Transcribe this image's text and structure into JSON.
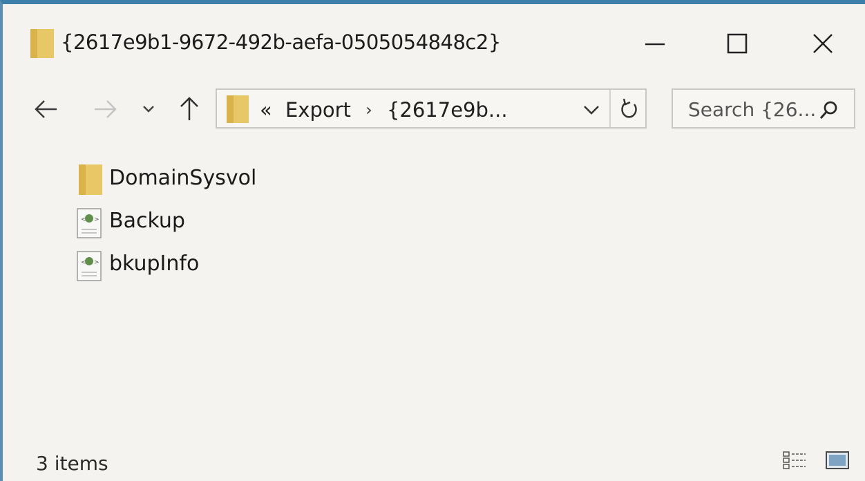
{
  "window": {
    "title": "{2617e9b1-9672-492b-aefa-0505054848c2}",
    "accent_color": "#3c7fa8"
  },
  "titlebar": {
    "icon": "folder-icon",
    "buttons": [
      "minimize-icon",
      "maximize-icon",
      "close-icon"
    ]
  },
  "navigation": {
    "buttons": [
      "back-arrow-icon",
      "forward-arrow-icon",
      "recent-locations-chevron-icon",
      "up-arrow-icon"
    ]
  },
  "address_bar": {
    "overflow": "«",
    "crumbs": [
      "Export",
      "{2617e9b..."
    ],
    "separator": "›",
    "icon": "folder-icon"
  },
  "search": {
    "placeholder": "Search {26...",
    "icon": "search-icon"
  },
  "files": [
    {
      "name": "DomainSysvol",
      "icon": "folder-icon"
    },
    {
      "name": "Backup",
      "icon": "xml-document-icon"
    },
    {
      "name": "bkupInfo",
      "icon": "xml-document-icon"
    }
  ],
  "status": {
    "item_count": "3 items"
  },
  "colors": {
    "folder": "#e8c766",
    "folder_dark": "#d9b24a",
    "background": "#f4f3ef"
  }
}
